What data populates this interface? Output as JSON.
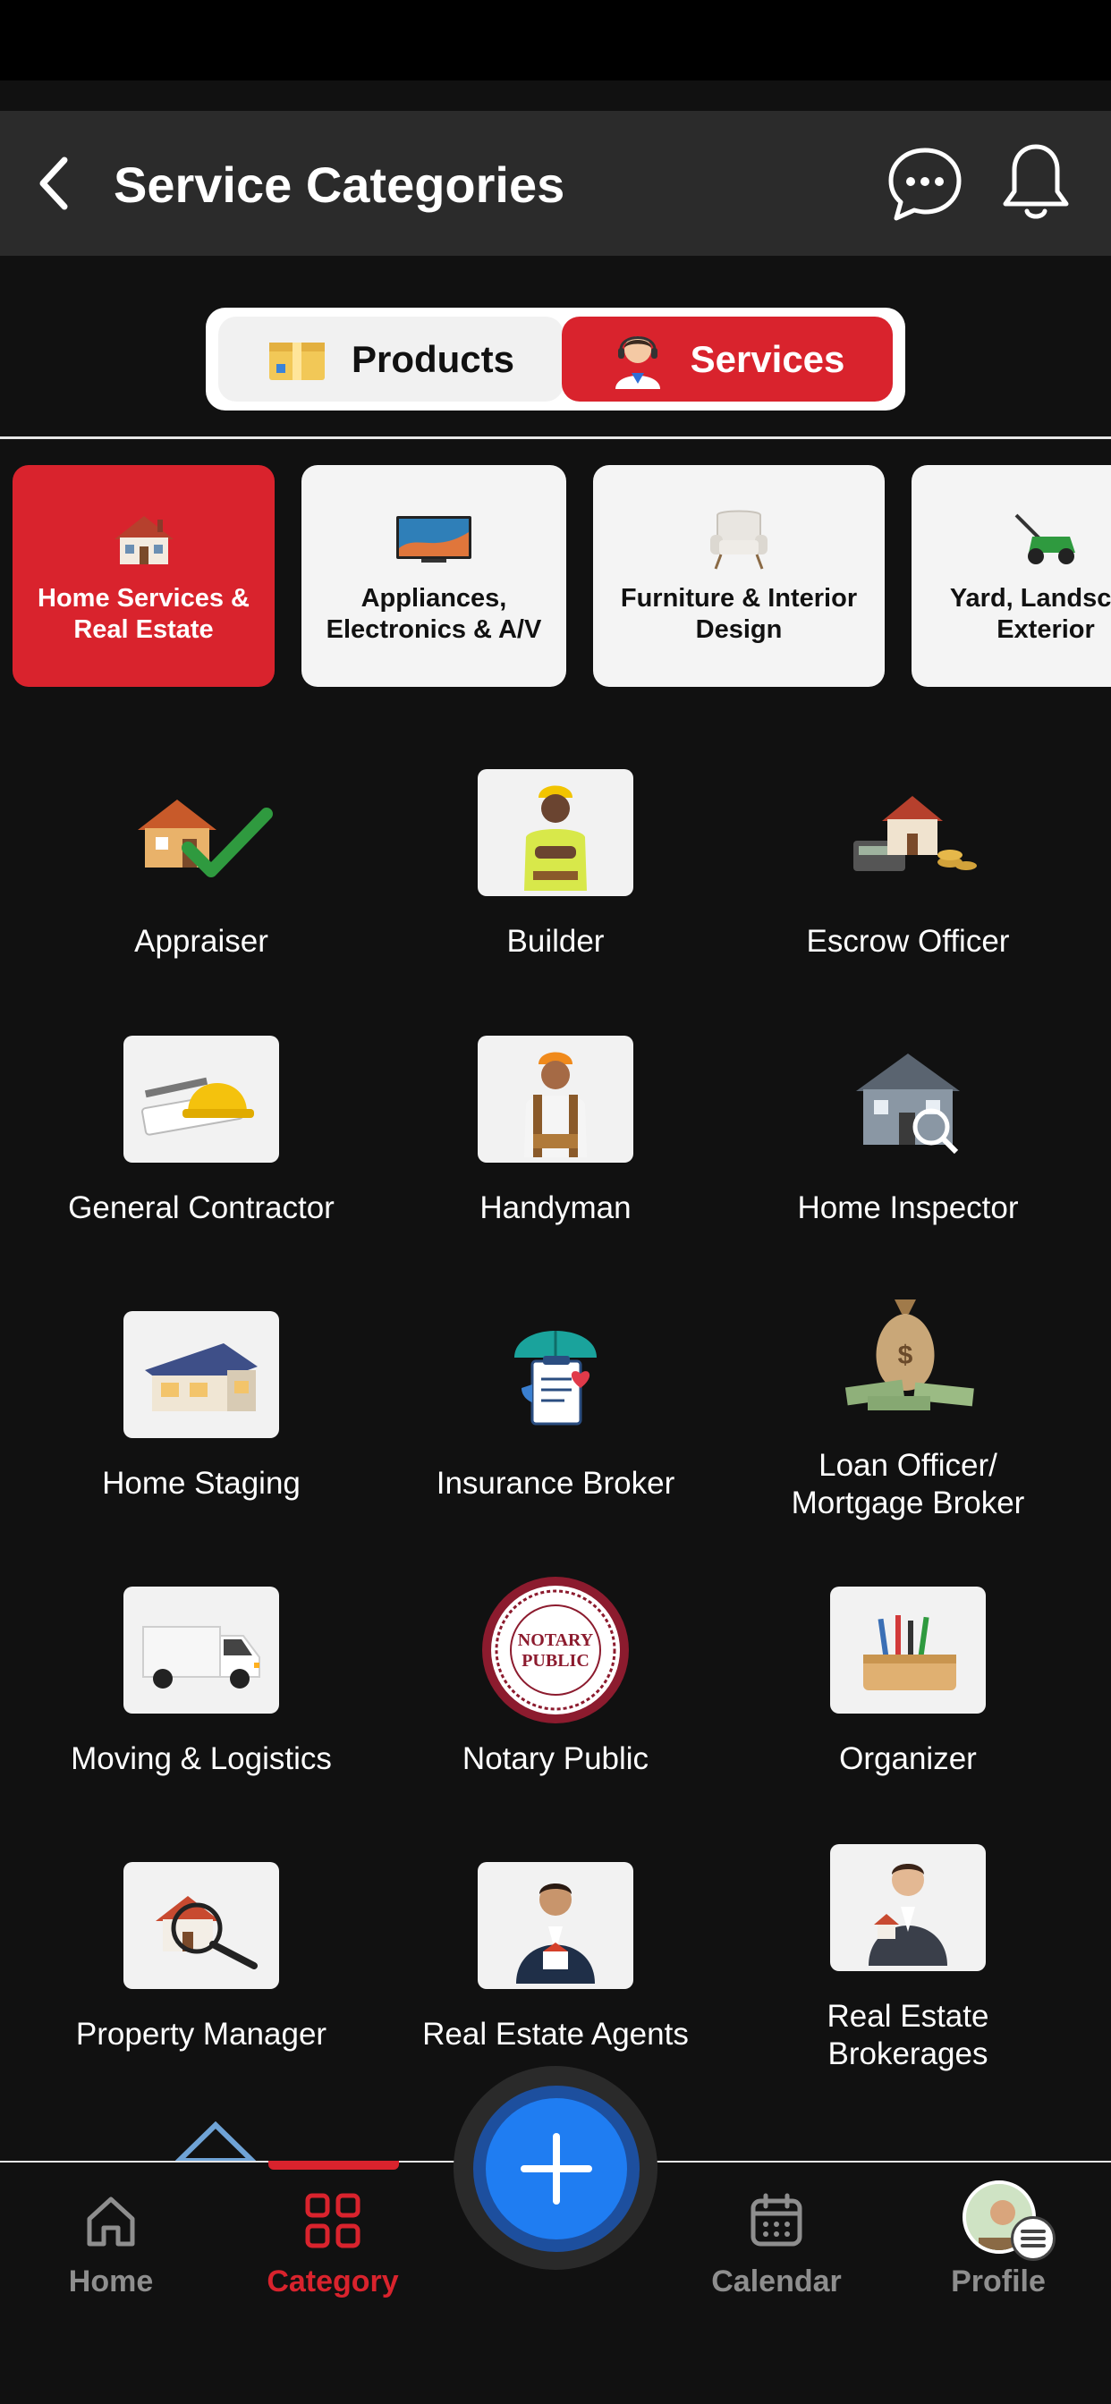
{
  "header": {
    "title": "Service Categories",
    "back_icon": "chevron-left-icon",
    "chat_icon": "chat-bubble-icon",
    "notification_icon": "bell-icon"
  },
  "toggle": {
    "products_label": "Products",
    "services_label": "Services",
    "selected": "Services"
  },
  "categories": [
    {
      "label": "Home Services &\nReal Estate",
      "icon": "house-icon",
      "active": true
    },
    {
      "label": "Appliances,\nElectronics & A/V",
      "icon": "tv-icon",
      "active": false
    },
    {
      "label": "Furniture & Interior\nDesign",
      "icon": "armchair-icon",
      "active": false
    },
    {
      "label": "Yard, Landscap\nExterior",
      "icon": "lawn-mower-icon",
      "active": false
    }
  ],
  "services": [
    {
      "label": "Appraiser",
      "icon": "house-check-icon"
    },
    {
      "label": "Builder",
      "icon": "builder-icon"
    },
    {
      "label": "Escrow Officer",
      "icon": "house-coins-icon"
    },
    {
      "label": "General Contractor",
      "icon": "hard-hat-icon"
    },
    {
      "label": "Handyman",
      "icon": "handyman-icon"
    },
    {
      "label": "Home Inspector",
      "icon": "house-magnifier-icon"
    },
    {
      "label": "Home Staging",
      "icon": "modern-house-icon"
    },
    {
      "label": "Insurance Broker",
      "icon": "umbrella-clipboard-icon"
    },
    {
      "label": "Loan Officer/\nMortgage Broker",
      "icon": "money-bag-icon"
    },
    {
      "label": "Moving & Logistics",
      "icon": "van-icon"
    },
    {
      "label": "Notary Public",
      "icon": "notary-seal-icon",
      "seal_text": "NOTARY\nPUBLIC"
    },
    {
      "label": "Organizer",
      "icon": "desk-organizer-icon"
    },
    {
      "label": "Property Manager",
      "icon": "house-magnifier-icon"
    },
    {
      "label": "Real Estate Agents",
      "icon": "agent-icon"
    },
    {
      "label": "Real Estate\nBrokerages",
      "icon": "broker-icon"
    }
  ],
  "nav": {
    "home_label": "Home",
    "category_label": "Category",
    "calendar_label": "Calendar",
    "profile_label": "Profile",
    "active": "Category"
  },
  "colors": {
    "accent": "#d9232d",
    "fab": "#1f7df2",
    "background": "#111111",
    "header": "#2b2b2b"
  }
}
